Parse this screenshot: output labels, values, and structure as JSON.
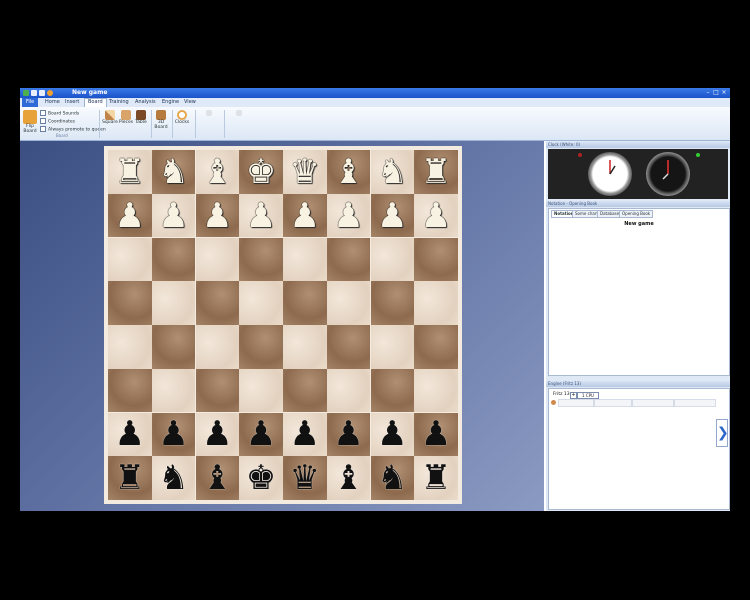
{
  "window": {
    "title": "New game"
  },
  "ribbon": {
    "file_tab": "File",
    "tabs": [
      "Home",
      "Insert",
      "Board",
      "Training",
      "Analysis",
      "Engine",
      "View"
    ],
    "active_tab": "Board",
    "buttons": {
      "flip_board": "Flip Board",
      "square": "Square",
      "pieces": "Pieces",
      "table": "Table",
      "board_3d": "3D Board",
      "clocks": "Clocks"
    },
    "checkboxes": {
      "board_sounds": "Board Sounds",
      "coordinates": "Coordinates",
      "always_promote": "Always promote to queen"
    },
    "groups": {
      "board": "Board"
    },
    "colors": {
      "title": "#1b52c9",
      "accent": "#2f6bd6"
    }
  },
  "right_panel": {
    "clock_title": "Clock (White: 0)",
    "notation_title": "Notation - Opening Book",
    "notation_tabs": [
      "Notation",
      "Some chart",
      "Database",
      "Opening Book"
    ],
    "notation_active": "Notation",
    "notation_content": "New game",
    "engine_title": "Engine (Fritz 13)",
    "engine_name": "Fritz 13",
    "engine_plus": "+",
    "engine_cpu": "1 CPU"
  },
  "board": {
    "rows": [
      [
        "♜",
        "♞",
        "♝",
        "♚",
        "♛",
        "♝",
        "♞",
        "♜"
      ],
      [
        "♟",
        "♟",
        "♟",
        "♟",
        "♟",
        "♟",
        "♟",
        "♟"
      ],
      [
        "",
        "",
        "",
        "",
        "",
        "",
        "",
        ""
      ],
      [
        "",
        "",
        "",
        "",
        "",
        "",
        "",
        ""
      ],
      [
        "",
        "",
        "",
        "",
        "",
        "",
        "",
        ""
      ],
      [
        "",
        "",
        "",
        "",
        "",
        "",
        "",
        ""
      ],
      [
        "♟",
        "♟",
        "♟",
        "♟",
        "♟",
        "♟",
        "♟",
        "♟"
      ],
      [
        "♜",
        "♞",
        "♝",
        "♚",
        "♛",
        "♝",
        "♞",
        "♜"
      ]
    ],
    "colors": [
      "white",
      "white",
      "",
      "",
      "",
      "",
      "black",
      "black"
    ]
  }
}
